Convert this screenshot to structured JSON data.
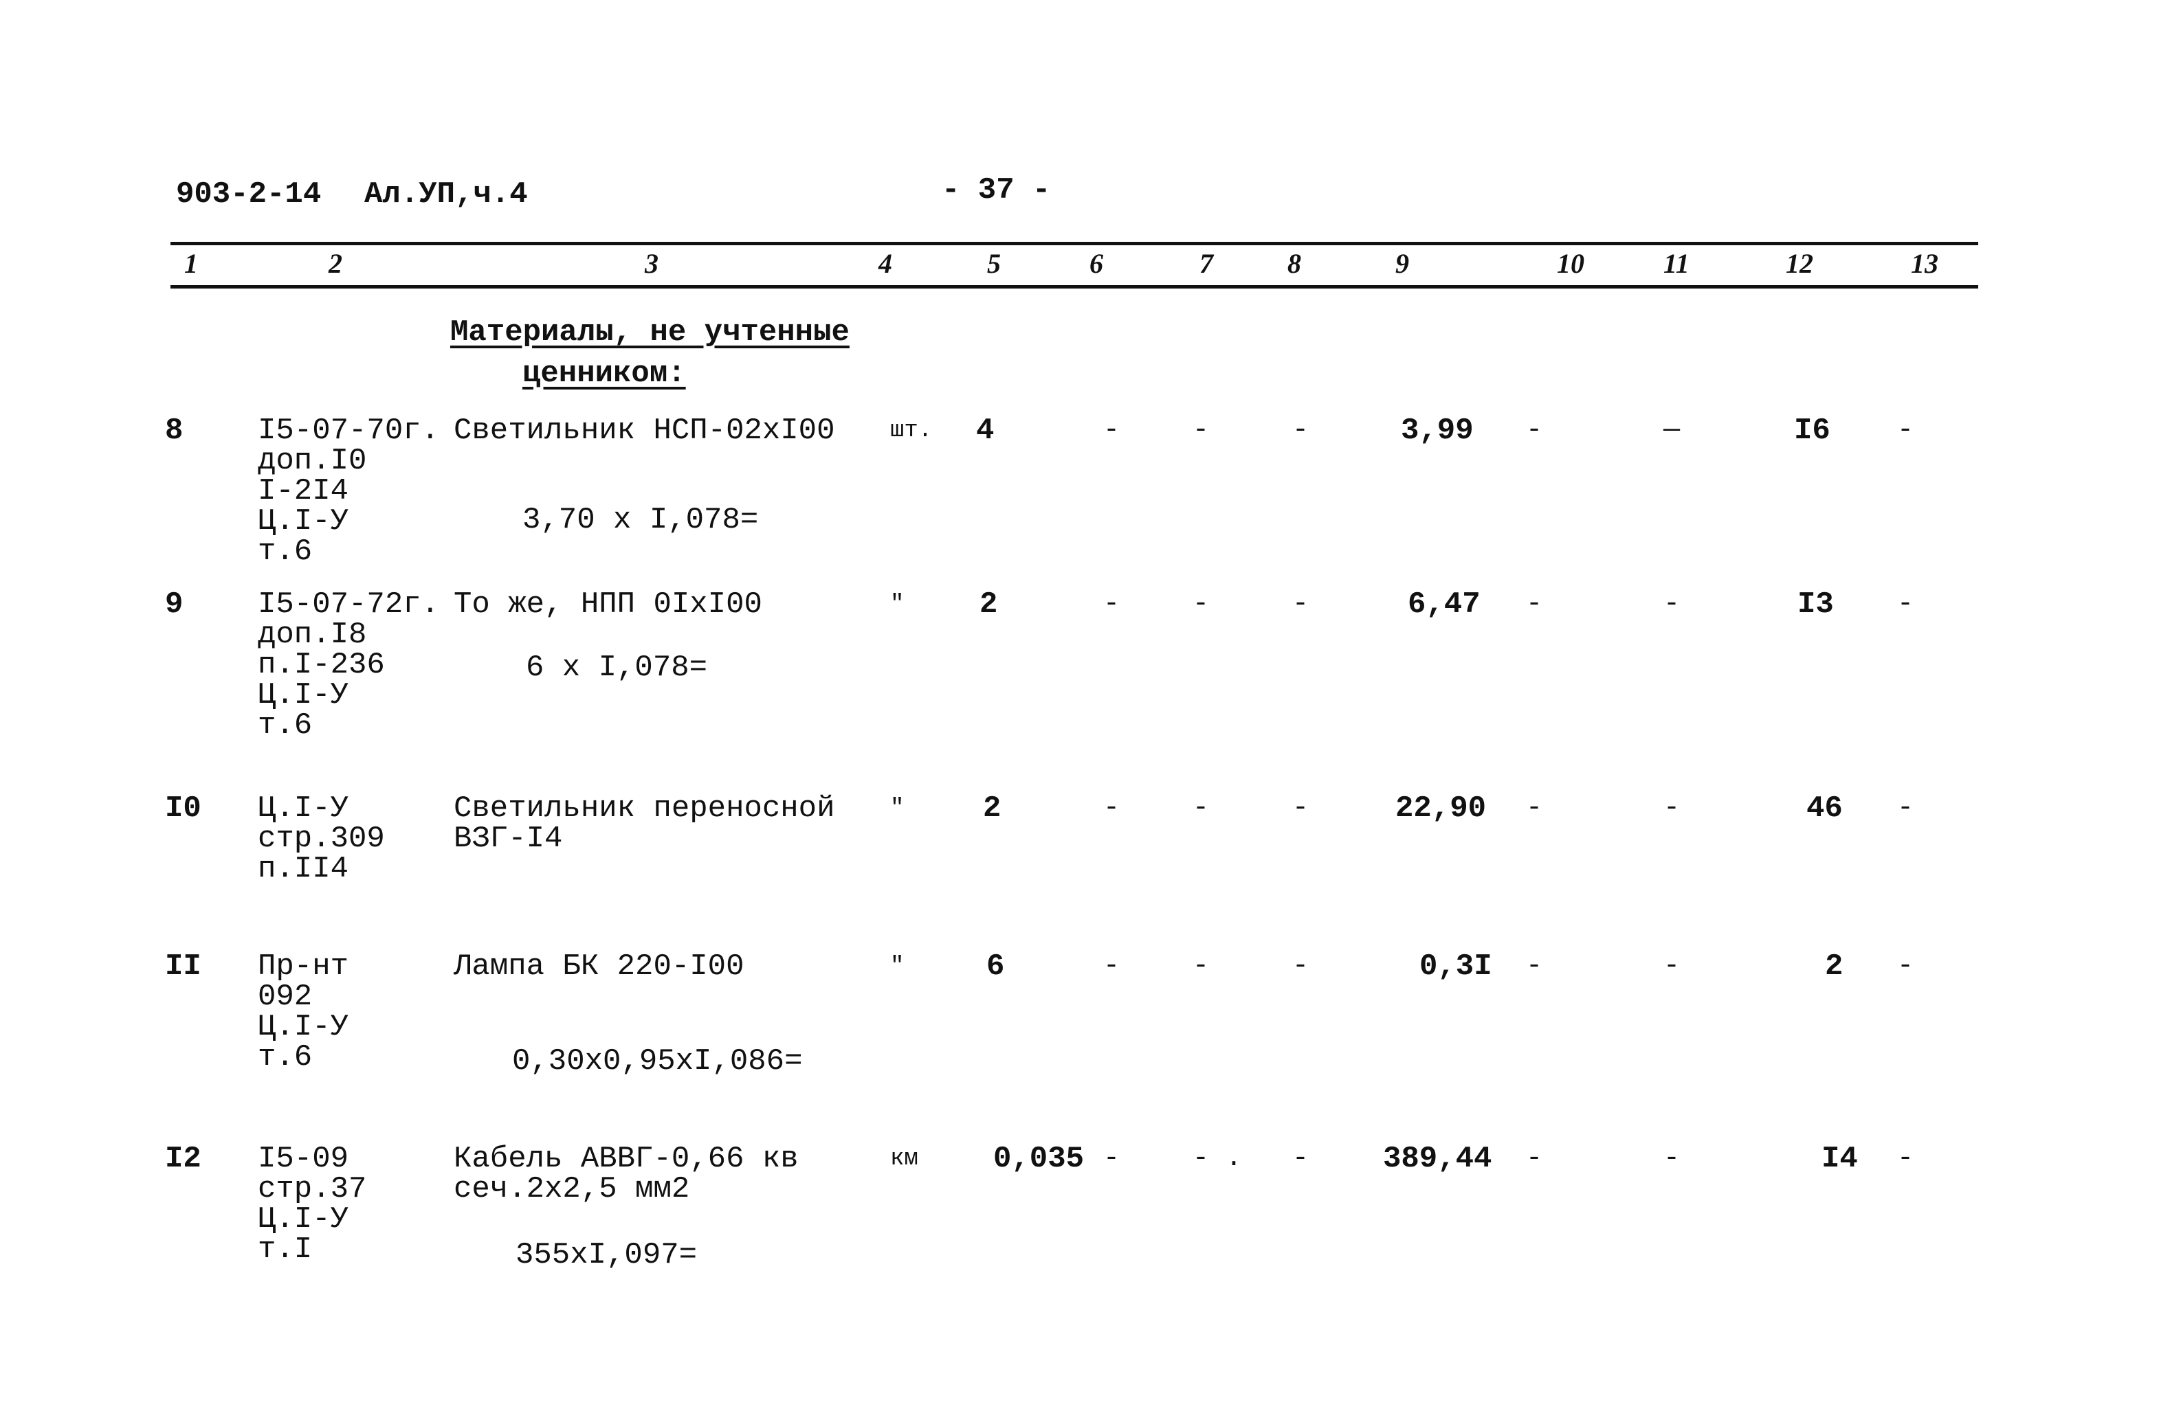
{
  "header": {
    "doc_code": "903-2-14",
    "section": "Ал.УП,ч.4",
    "page_number": "- 37 -"
  },
  "column_numbers": [
    "1",
    "2",
    "3",
    "4",
    "5",
    "6",
    "7",
    "8",
    "9",
    "10",
    "11",
    "12",
    "13"
  ],
  "section_title": {
    "line1": "Материалы, не учтенные",
    "line2": "ценником:"
  },
  "rows": [
    {
      "num": "8",
      "ref": [
        "I5-07-70г.",
        "доп.I0",
        "I-2I4",
        "Ц.I-У",
        "т.6"
      ],
      "name": [
        "Светильник НСП-02хI00"
      ],
      "calc": "3,70 x I,078=",
      "unit": "шт.",
      "qty": "4",
      "c6": "-",
      "c7": "-",
      "c8": "-",
      "price": "3,99",
      "c10": "-",
      "c11": "—",
      "total": "I6",
      "c13": "-"
    },
    {
      "num": "9",
      "ref": [
        "I5-07-72г.",
        "доп.I8",
        "п.I-236",
        "Ц.I-У",
        "т.6"
      ],
      "name": [
        "То же, НПП 0IхI00"
      ],
      "calc": "6 х I,078=",
      "unit": "\"",
      "qty": "2",
      "c6": "-",
      "c7": "-",
      "c8": "-",
      "price": "6,47",
      "c10": "-",
      "c11": "-",
      "total": "I3",
      "c13": "-"
    },
    {
      "num": "I0",
      "ref": [
        "Ц.I-У",
        "стр.309",
        "п.II4"
      ],
      "name": [
        "Светильник переносной",
        "ВЗГ-I4"
      ],
      "calc": "",
      "unit": "\"",
      "qty": "2",
      "c6": "-",
      "c7": "-",
      "c8": "-",
      "price": "22,90",
      "c10": "-",
      "c11": "-",
      "total": "46",
      "c13": "-"
    },
    {
      "num": "II",
      "ref": [
        "Пр-нт",
        "092",
        "Ц.I-У",
        "т.6"
      ],
      "name": [
        "Лампа БК 220-I00"
      ],
      "calc": "0,30х0,95хI,086=",
      "unit": "\"",
      "qty": "6",
      "c6": "-",
      "c7": "-",
      "c8": "-",
      "price": "0,3I",
      "c10": "-",
      "c11": "-",
      "total": "2",
      "c13": "-"
    },
    {
      "num": "I2",
      "ref": [
        "I5-09",
        "стр.37",
        "Ц.I-У",
        "т.I"
      ],
      "name": [
        "Кабель АВВГ-0,66 кв",
        "сеч.2х2,5 мм2"
      ],
      "calc": "355хI,097=",
      "unit": "км",
      "qty": "0,035",
      "c6": "-",
      "c7": "- .",
      "c8": "-",
      "price": "389,44",
      "c10": "-",
      "c11": "-",
      "total": "I4",
      "c13": "-"
    }
  ]
}
